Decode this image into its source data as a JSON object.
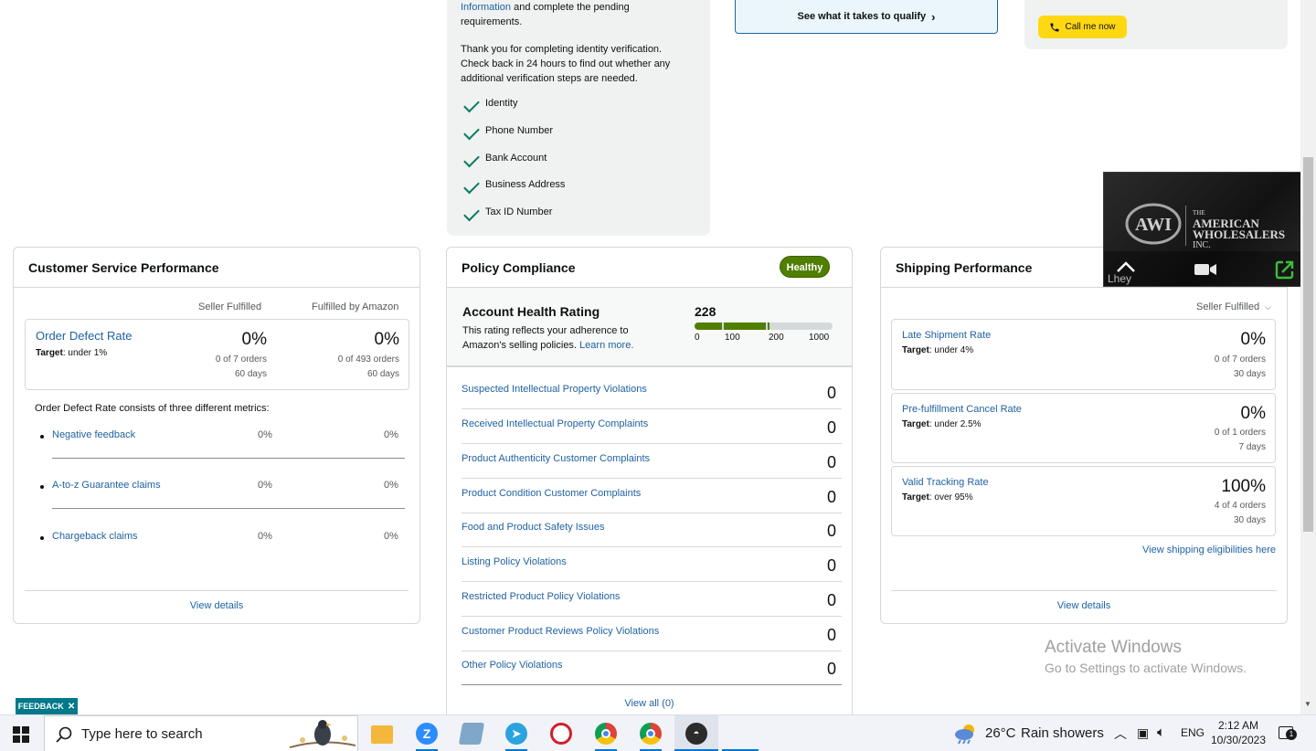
{
  "verification": {
    "info_link": "Information",
    "info_rest": "and complete the pending",
    "info_line2": "requirements.",
    "thanks_line1": "Thank you for completing identity verification.",
    "thanks_line2": "Check back in 24 hours to find out whether any",
    "thanks_line3": "additional verification steps are needed.",
    "items": [
      "Identity",
      "Phone Number",
      "Bank Account",
      "Business Address",
      "Tax ID Number"
    ]
  },
  "qualify": {
    "label": "See what it takes to qualify"
  },
  "call": {
    "label": "Call me now"
  },
  "csp": {
    "title": "Customer Service Performance",
    "col1": "Seller Fulfilled",
    "col2": "Fulfilled by Amazon",
    "odr": {
      "label": "Order Defect Rate",
      "target_label": "Target",
      "target": ": under 1%",
      "sf_value": "0%",
      "sf_orders": "0 of 7 orders",
      "sf_days": "60 days",
      "fba_value": "0%",
      "fba_orders": "0 of 493 orders",
      "fba_days": "60 days"
    },
    "consists": "Order Defect Rate consists of three different metrics:",
    "metrics": [
      {
        "label": "Negative feedback",
        "sf": "0%",
        "fba": "0%"
      },
      {
        "label": "A-to-z Guarantee claims",
        "sf": "0%",
        "fba": "0%"
      },
      {
        "label": "Chargeback claims",
        "sf": "0%",
        "fba": "0%"
      }
    ],
    "view_details": "View details"
  },
  "policy": {
    "title": "Policy Compliance",
    "badge": "Healthy",
    "ahr_title": "Account Health Rating",
    "ahr_desc1": "This rating reflects your adherence to",
    "ahr_desc2": "Amazon's selling policies.",
    "learn_more": "Learn more.",
    "score": 228,
    "scale_max": 1000,
    "ticks": [
      "0",
      "100",
      "200",
      "1000"
    ],
    "rows": [
      {
        "label": "Suspected Intellectual Property Violations",
        "value": "0"
      },
      {
        "label": "Received Intellectual Property Complaints",
        "value": "0"
      },
      {
        "label": "Product Authenticity Customer Complaints",
        "value": "0"
      },
      {
        "label": "Product Condition Customer Complaints",
        "value": "0"
      },
      {
        "label": "Food and Product Safety Issues",
        "value": "0"
      },
      {
        "label": "Listing Policy Violations",
        "value": "0"
      },
      {
        "label": "Restricted Product Policy Violations",
        "value": "0"
      },
      {
        "label": "Customer Product Reviews Policy Violations",
        "value": "0"
      },
      {
        "label": "Other Policy Violations",
        "value": "0"
      }
    ],
    "view_all": "View all (0)"
  },
  "shipping": {
    "title": "Shipping Performance",
    "filter": "Seller Fulfilled",
    "metrics": [
      {
        "label": "Late Shipment Rate",
        "target_label": "Target",
        "target": ": under 4%",
        "value": "0%",
        "orders": "0 of 7 orders",
        "days": "30 days"
      },
      {
        "label": "Pre-fulfillment Cancel Rate",
        "target_label": "Target",
        "target": ": under 2.5%",
        "value": "0%",
        "orders": "0 of 1 orders",
        "days": "7 days"
      },
      {
        "label": "Valid Tracking Rate",
        "target_label": "Target",
        "target": ": over 95%",
        "value": "100%",
        "orders": "4 of 4 orders",
        "days": "30 days"
      }
    ],
    "eligibility_link": "View shipping eligibilities here",
    "view_details": "View details"
  },
  "video": {
    "line1": "THE",
    "line2": "AMERICAN",
    "line3": "WHOLESALERS",
    "line4": "INC.",
    "caption": "Lhey"
  },
  "watermark": {
    "line1": "Activate Windows",
    "line2": "Go to Settings to activate Windows."
  },
  "feedback": {
    "label": "FEEDBACK"
  },
  "taskbar": {
    "search_placeholder": "Type here to search",
    "weather_temp": "26°C",
    "weather_text": "Rain showers",
    "lang": "ENG",
    "time": "2:12 AM",
    "date": "10/30/2023",
    "notif_count": "1"
  }
}
